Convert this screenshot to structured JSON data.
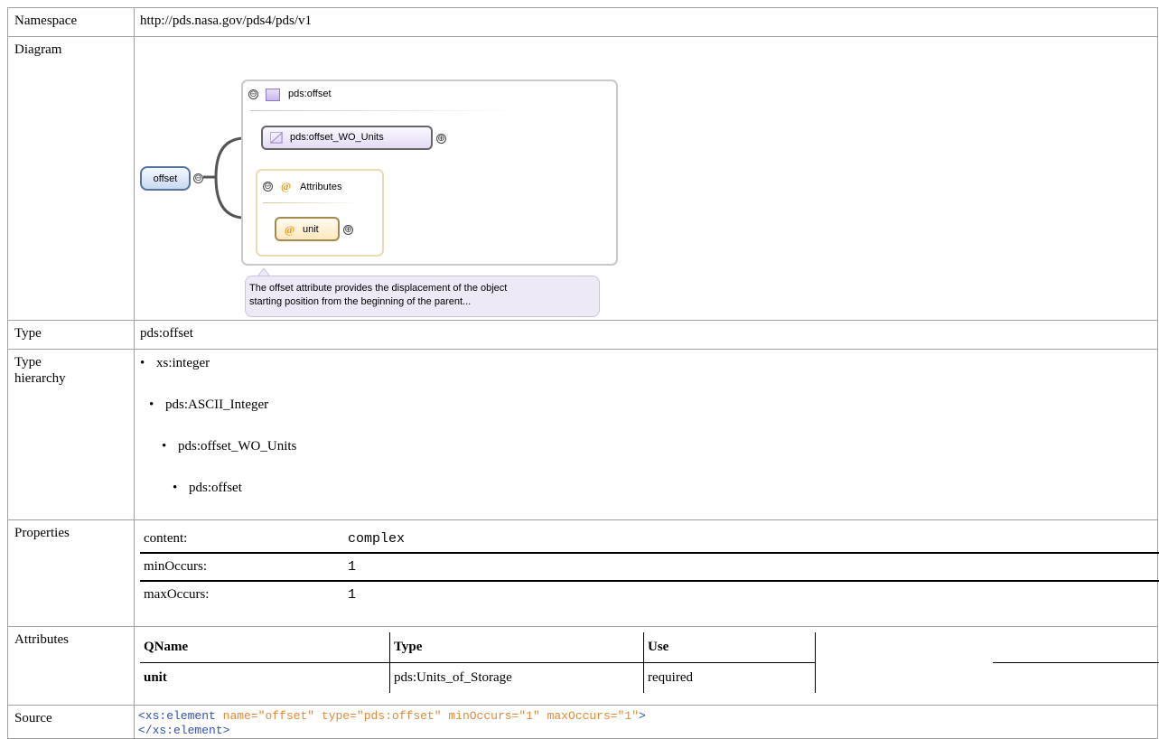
{
  "namespace": {
    "label": "Namespace",
    "value": "http://pds.nasa.gov/pds4/pds/v1"
  },
  "diagram": {
    "label": "Diagram",
    "element": "offset",
    "type_header": "pds:offset",
    "base": "pds:offset_WO_Units",
    "attributes_label": "Attributes",
    "attr": "unit",
    "at_symbol": "@",
    "minus": "⊖",
    "plus": "⊕",
    "tooltip_line1": "The offset attribute provides the displacement of the object",
    "tooltip_line2": "starting position from the beginning of the parent..."
  },
  "type": {
    "label": "Type",
    "value": "pds:offset"
  },
  "type_hierarchy": {
    "label_line1": "Type",
    "label_line2": "hierarchy",
    "bullet": "•",
    "items": [
      "xs:integer",
      "pds:ASCII_Integer",
      "pds:offset_WO_Units",
      "pds:offset"
    ]
  },
  "properties": {
    "label": "Properties",
    "rows": [
      {
        "key": "content:",
        "value": "complex"
      },
      {
        "key": "minOccurs:",
        "value": "1"
      },
      {
        "key": "maxOccurs:",
        "value": "1"
      }
    ]
  },
  "attributes": {
    "label": "Attributes",
    "headers": [
      "QName",
      "Type",
      "Use"
    ],
    "row": {
      "qname": "unit",
      "type": "pds:Units_of_Storage",
      "use": "required"
    }
  },
  "source": {
    "label": "Source",
    "open_tag": "<xs:element",
    "a1": "name=",
    "v1": "\"offset\"",
    "a2": "type=",
    "v2": "\"pds:offset\"",
    "a3": "minOccurs=",
    "v3": "\"1\"",
    "a4": "maxOccurs=",
    "v4": "\"1\"",
    "gt": ">",
    "close_tag": "</xs:element>"
  }
}
